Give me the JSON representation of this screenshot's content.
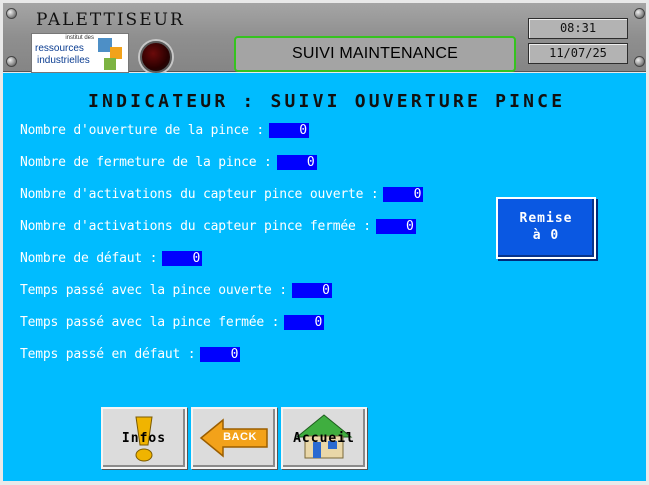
{
  "header": {
    "app_title": "PALETTISEUR",
    "logo": {
      "line1": "institut des",
      "line2": "ressources",
      "line3": "industrielles"
    },
    "screen_title": "SUIVI MAINTENANCE",
    "time": "08:31",
    "date": "11/07/25"
  },
  "main": {
    "heading": "INDICATEUR : SUIVI OUVERTURE PINCE",
    "rows": [
      {
        "label": "Nombre d'ouverture de la pince :",
        "value": "0"
      },
      {
        "label": "Nombre de fermeture de la pince :",
        "value": "0"
      },
      {
        "label": "Nombre d'activations du capteur pince ouverte :",
        "value": "0"
      },
      {
        "label": "Nombre d'activations du capteur pince fermée :",
        "value": "0"
      },
      {
        "label": "Nombre de défaut :",
        "value": "0"
      },
      {
        "label": "Temps passé avec la pince ouverte :",
        "value": "0"
      },
      {
        "label": "Temps passé avec la pince fermée :",
        "value": "0"
      },
      {
        "label": "Temps passé en défaut :",
        "value": "0"
      }
    ],
    "reset_button": {
      "line1": "Remise",
      "line2": "à 0"
    }
  },
  "nav": {
    "infos_label": "Infos",
    "back_label": "BACK",
    "accueil_label": "Accueil"
  },
  "colors": {
    "panel_bg": "#00bcff",
    "value_box": "#0000ff",
    "reset_button": "#0a58e2",
    "title_border": "#35c31f"
  },
  "icons": [
    "exclamation-icon",
    "back-arrow-icon",
    "house-icon",
    "indicator-light"
  ]
}
